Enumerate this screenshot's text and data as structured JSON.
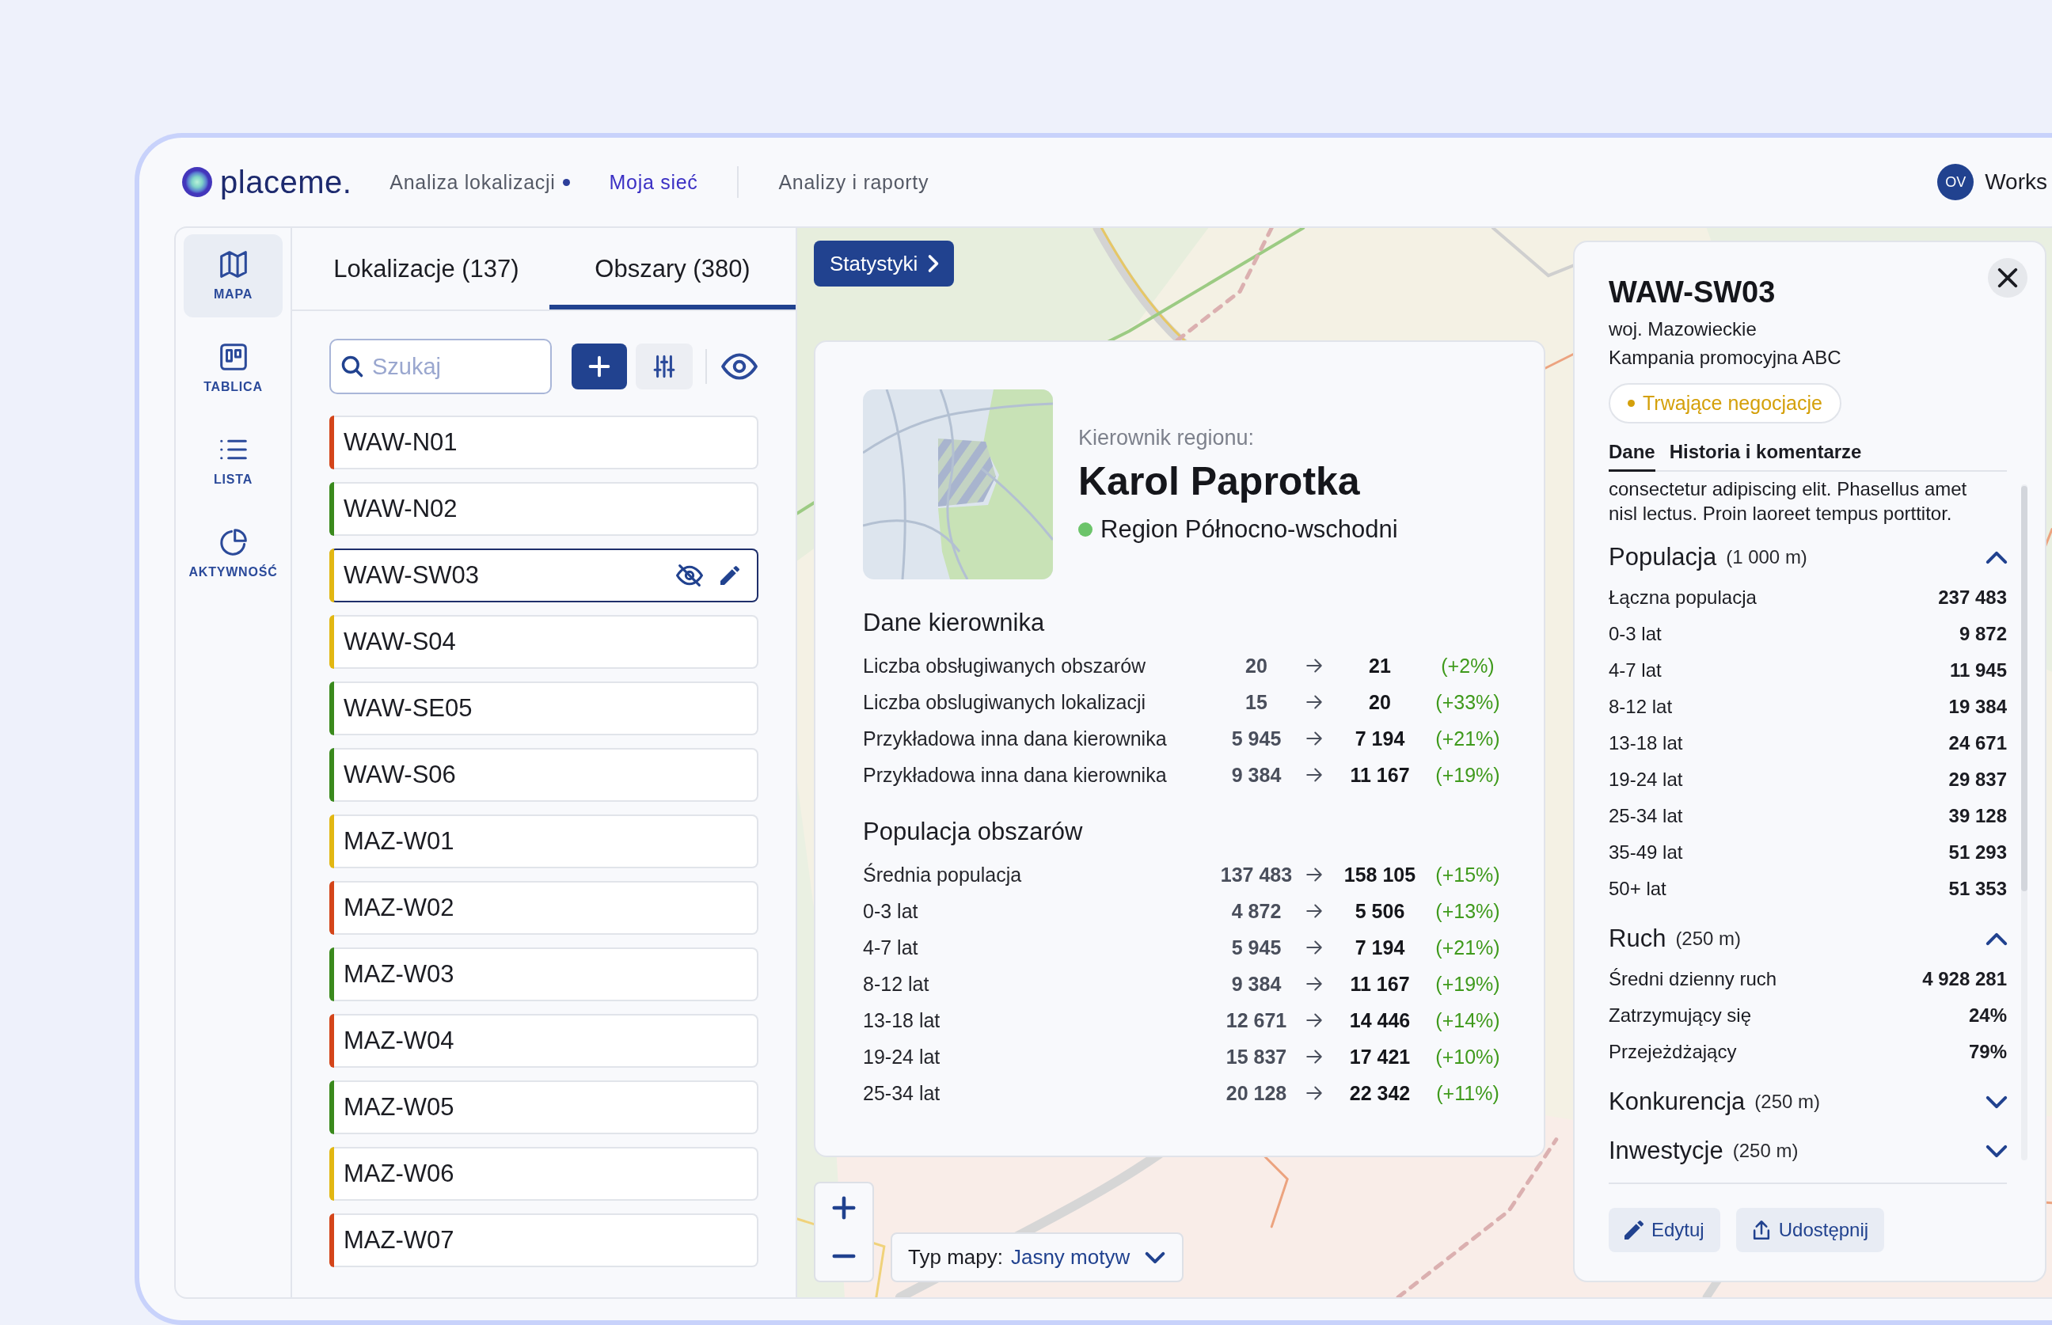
{
  "header": {
    "logo": "placeme.",
    "nav_groups": [
      {
        "items": [
          {
            "label": "Analiza lokalizacji",
            "notification": true,
            "selected": false
          },
          {
            "label": "Moja sieć",
            "notification": false,
            "selected": true
          }
        ]
      },
      {
        "items": [
          {
            "label": "Analizy i raporty",
            "notification": false,
            "selected": false
          }
        ]
      }
    ],
    "user": {
      "initials": "OV",
      "workspace": "Works"
    }
  },
  "rail": [
    {
      "label": "MAPA",
      "selected": true
    },
    {
      "label": "TABLICA",
      "selected": false
    },
    {
      "label": "LISTA",
      "selected": false
    },
    {
      "label": "AKTYWNOŚĆ",
      "selected": false
    }
  ],
  "list_panel": {
    "tabs": [
      {
        "label": "Lokalizacje (137)",
        "selected": false
      },
      {
        "label": "Obszary (380)",
        "selected": true
      }
    ],
    "search": {
      "placeholder": "Szukaj"
    },
    "items": [
      {
        "name": "WAW-N01",
        "color": "#d4451a",
        "selected": false
      },
      {
        "name": "WAW-N02",
        "color": "#3a8a1d",
        "selected": false
      },
      {
        "name": "WAW-SW03",
        "color": "#e2b712",
        "selected": true
      },
      {
        "name": "WAW-S04",
        "color": "#e2b712",
        "selected": false
      },
      {
        "name": "WAW-SE05",
        "color": "#3a8a1d",
        "selected": false
      },
      {
        "name": "WAW-S06",
        "color": "#3a8a1d",
        "selected": false
      },
      {
        "name": "MAZ-W01",
        "color": "#e2b712",
        "selected": false
      },
      {
        "name": "MAZ-W02",
        "color": "#d4451a",
        "selected": false
      },
      {
        "name": "MAZ-W03",
        "color": "#3a8a1d",
        "selected": false
      },
      {
        "name": "MAZ-W04",
        "color": "#d4451a",
        "selected": false
      },
      {
        "name": "MAZ-W05",
        "color": "#3a8a1d",
        "selected": false
      },
      {
        "name": "MAZ-W06",
        "color": "#e2b712",
        "selected": false
      },
      {
        "name": "MAZ-W07",
        "color": "#d4451a",
        "selected": false
      }
    ]
  },
  "map": {
    "stats_button": "Statystyki",
    "map_type": {
      "label": "Typ mapy:",
      "value": "Jasny motyw"
    }
  },
  "manager_card": {
    "role_label": "Kierownik regionu:",
    "name": "Karol Paprotka",
    "region": "Region Północno-wschodni",
    "sections": [
      {
        "title": "Dane kierownika",
        "rows": [
          {
            "label": "Liczba obsługiwanych obszarów",
            "before": "20",
            "after": "21",
            "change": "(+2%)"
          },
          {
            "label": "Liczba obslugiwanych lokalizacji",
            "before": "15",
            "after": "20",
            "change": "(+33%)"
          },
          {
            "label": "Przykładowa inna dana kierownika",
            "before": "5 945",
            "after": "7 194",
            "change": "(+21%)"
          },
          {
            "label": "Przykładowa inna dana kierownika",
            "before": "9 384",
            "after": "11 167",
            "change": "(+19%)"
          }
        ]
      },
      {
        "title": "Populacja obszarów",
        "rows": [
          {
            "label": "Średnia populacja",
            "before": "137 483",
            "after": "158 105",
            "change": "(+15%)"
          },
          {
            "label": "0-3 lat",
            "before": "4 872",
            "after": "5 506",
            "change": "(+13%)"
          },
          {
            "label": "4-7 lat",
            "before": "5 945",
            "after": "7 194",
            "change": "(+21%)"
          },
          {
            "label": "8-12 lat",
            "before": "9 384",
            "after": "11 167",
            "change": "(+19%)"
          },
          {
            "label": "13-18 lat",
            "before": "12 671",
            "after": "14 446",
            "change": "(+14%)"
          },
          {
            "label": "19-24 lat",
            "before": "15 837",
            "after": "17 421",
            "change": "(+10%)"
          },
          {
            "label": "25-34 lat",
            "before": "20 128",
            "after": "22 342",
            "change": "(+11%)"
          }
        ]
      }
    ]
  },
  "detail_panel": {
    "title": "WAW-SW03",
    "subtitle": "woj. Mazowieckie",
    "campaign": "Kampania promocyjna ABC",
    "status": "Trwające negocjacje",
    "tabs": [
      {
        "label": "Dane",
        "selected": true
      },
      {
        "label": "Historia i komentarze",
        "selected": false
      }
    ],
    "description": "consectetur adipiscing elit. Phasellus amet nisl lectus. Proin laoreet tempus porttitor.",
    "sections": [
      {
        "title": "Populacja",
        "range": "(1 000 m)",
        "expanded": true,
        "rows": [
          {
            "label": "Łączna populacja",
            "value": "237 483"
          },
          {
            "label": "0-3 lat",
            "value": "9 872"
          },
          {
            "label": "4-7 lat",
            "value": "11 945"
          },
          {
            "label": "8-12 lat",
            "value": "19 384"
          },
          {
            "label": "13-18 lat",
            "value": "24 671"
          },
          {
            "label": "19-24 lat",
            "value": "29 837"
          },
          {
            "label": "25-34 lat",
            "value": "39 128"
          },
          {
            "label": "35-49 lat",
            "value": "51 293"
          },
          {
            "label": "50+ lat",
            "value": "51 353"
          }
        ]
      },
      {
        "title": "Ruch",
        "range": "(250 m)",
        "expanded": true,
        "rows": [
          {
            "label": "Średni dzienny ruch",
            "value": "4 928 281"
          },
          {
            "label": "Zatrzymujący się",
            "value": "24%"
          },
          {
            "label": "Przejeżdżający",
            "value": "79%"
          }
        ]
      },
      {
        "title": "Konkurencja",
        "range": "(250 m)",
        "expanded": false
      },
      {
        "title": "Inwestycje",
        "range": "(250 m)",
        "expanded": false
      }
    ],
    "actions": [
      "Edytuj",
      "Udostępnij"
    ]
  }
}
